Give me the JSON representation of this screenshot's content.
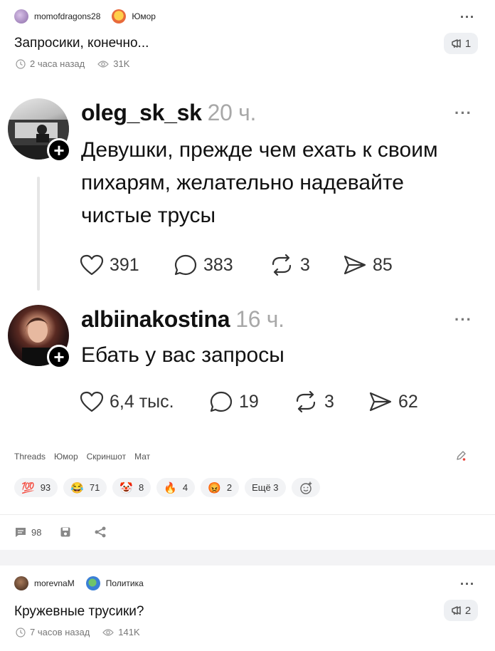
{
  "post1": {
    "author": "momofdragons28",
    "category": "Юмор",
    "title": "Запросики, конечно...",
    "time": "2 часа назад",
    "views": "31K",
    "badge_count": "1",
    "menu": "···",
    "tags": [
      "Threads",
      "Юмор",
      "Скриншот",
      "Мат"
    ],
    "reactions": [
      {
        "emoji": "💯",
        "count": "93"
      },
      {
        "emoji": "😂",
        "count": "71"
      },
      {
        "emoji": "🤡",
        "count": "8"
      },
      {
        "emoji": "🔥",
        "count": "4"
      },
      {
        "emoji": "😡",
        "count": "2"
      }
    ],
    "more_reactions": "Ещё 3",
    "comments": "98"
  },
  "screenshot": {
    "threads": [
      {
        "username": "oleg_sk_sk",
        "time": "20 ч.",
        "text": "Девушки, прежде чем ехать к своим пихарям, желательно надевайте чистые трусы",
        "likes": "391",
        "replies": "383",
        "reposts": "3",
        "shares": "85",
        "menu": "···"
      },
      {
        "username": "albiinakostina",
        "time": "16 ч.",
        "text": "Ебать у вас запросы",
        "likes": "6,4 тыс.",
        "replies": "19",
        "reposts": "3",
        "shares": "62",
        "menu": "···"
      }
    ]
  },
  "post2": {
    "author": "morevnaM",
    "category": "Политика",
    "title": "Кружевные трусики?",
    "time": "7 часов назад",
    "views": "141K",
    "badge_count": "2",
    "menu": "···"
  },
  "colors": {
    "accent_red": "#e8453c",
    "muted": "#777777",
    "background": "#f3f3f5"
  }
}
